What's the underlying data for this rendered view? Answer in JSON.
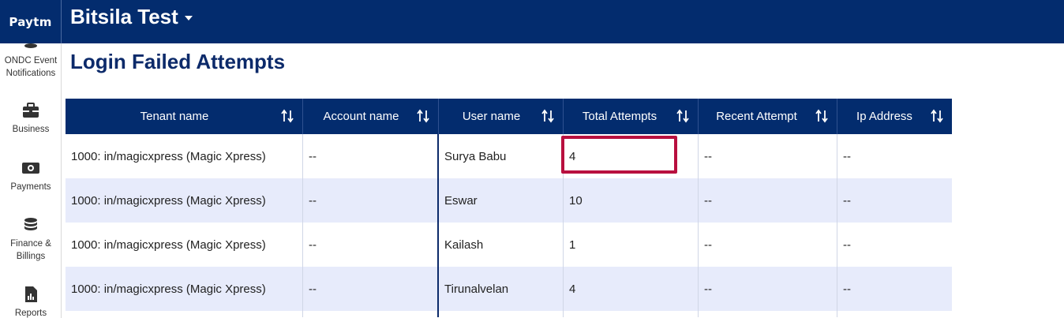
{
  "brand": {
    "logo": "Paytm"
  },
  "header": {
    "org_name": "Bitsila Test"
  },
  "sidebar": {
    "items": [
      {
        "label": "ONDC Event Notifications",
        "icon": "coins-icon"
      },
      {
        "label": "Business",
        "icon": "briefcase-icon"
      },
      {
        "label": "Payments",
        "icon": "cash-icon"
      },
      {
        "label": "Finance & Billings",
        "icon": "coins-icon"
      },
      {
        "label": "Reports",
        "icon": "report-icon"
      }
    ]
  },
  "page": {
    "title": "Login Failed Attempts"
  },
  "table": {
    "columns": [
      "Tenant name",
      "Account name",
      "User name",
      "Total Attempts",
      "Recent Attempt",
      "Ip Address"
    ],
    "rows": [
      [
        "1000: in/magicxpress (Magic Xpress)",
        "--",
        "Surya Babu",
        "4",
        "--",
        "--"
      ],
      [
        "1000: in/magicxpress (Magic Xpress)",
        "--",
        "Eswar",
        "10",
        "--",
        "--"
      ],
      [
        "1000: in/magicxpress (Magic Xpress)",
        "--",
        "Kailash",
        "1",
        "--",
        "--"
      ],
      [
        "1000: in/magicxpress (Magic Xpress)",
        "--",
        "Tirunalvelan",
        "4",
        "--",
        "--"
      ]
    ]
  },
  "colors": {
    "navy": "#032c6e",
    "row_alt": "#e7ebfb",
    "highlight": "#b8103f"
  }
}
